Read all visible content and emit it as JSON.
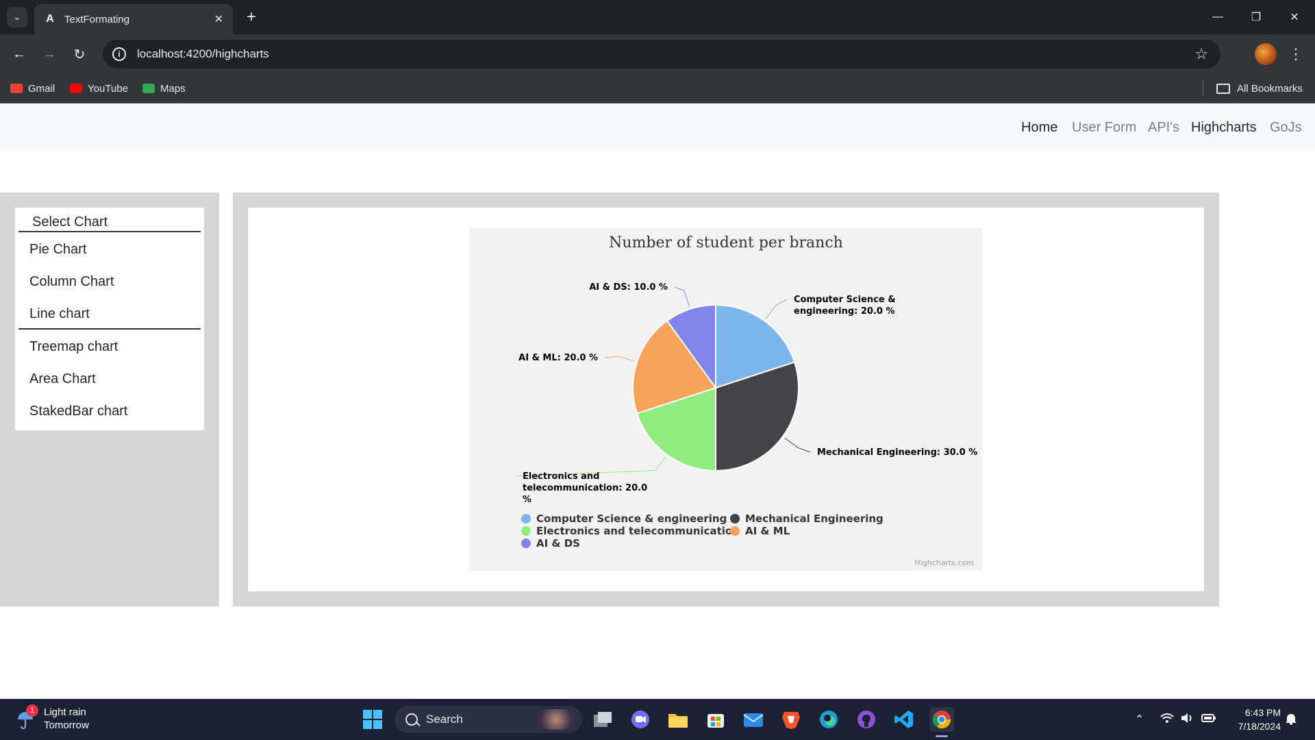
{
  "browser": {
    "tab_title": "TextFormating",
    "tab_favicon": "A",
    "url": "localhost:4200/highcharts",
    "bookmarks": [
      {
        "label": "Gmail",
        "icon": "gmail-icon",
        "color": "#ea4335"
      },
      {
        "label": "YouTube",
        "icon": "youtube-icon",
        "color": "#ff0000"
      },
      {
        "label": "Maps",
        "icon": "maps-icon",
        "color": "#34a853"
      }
    ],
    "all_bookmarks_label": "All Bookmarks"
  },
  "nav": {
    "links": [
      {
        "label": "Home",
        "active": true
      },
      {
        "label": "User Form",
        "active": false
      },
      {
        "label": "API's",
        "active": false
      },
      {
        "label": "Highcharts",
        "active": true
      },
      {
        "label": "GoJs",
        "active": false
      }
    ]
  },
  "menu": {
    "header": "Select Chart",
    "items": [
      "Pie Chart",
      "Column Chart",
      "Line chart",
      "Treemap chart",
      "Area Chart",
      "StakedBar chart"
    ]
  },
  "chart_data": {
    "type": "pie",
    "title": "Number of student per branch",
    "series": [
      {
        "name": "Computer Science & engineering",
        "value": 20.0,
        "color": "#7cb5ec",
        "label": "Computer Science & engineering: 20.0 %"
      },
      {
        "name": "Mechanical Engineering",
        "value": 30.0,
        "color": "#434348",
        "label": "Mechanical Engineering: 30.0 %"
      },
      {
        "name": "Electronics and telecommunication",
        "value": 20.0,
        "color": "#90ed7d",
        "label": "Electronics and telecommunication: 20.0 %"
      },
      {
        "name": "AI & ML",
        "value": 20.0,
        "color": "#f7a35c",
        "label": "AI & ML: 20.0 %"
      },
      {
        "name": "AI & DS",
        "value": 10.0,
        "color": "#8085e9",
        "label": "AI & DS: 10.0 %"
      }
    ],
    "legend": "bottom",
    "credits": "Highcharts.com"
  },
  "taskbar": {
    "weather_title": "Light rain",
    "weather_sub": "Tomorrow",
    "weather_badge": "1",
    "search_label": "Search",
    "time": "6:43 PM",
    "date": "7/18/2024"
  }
}
